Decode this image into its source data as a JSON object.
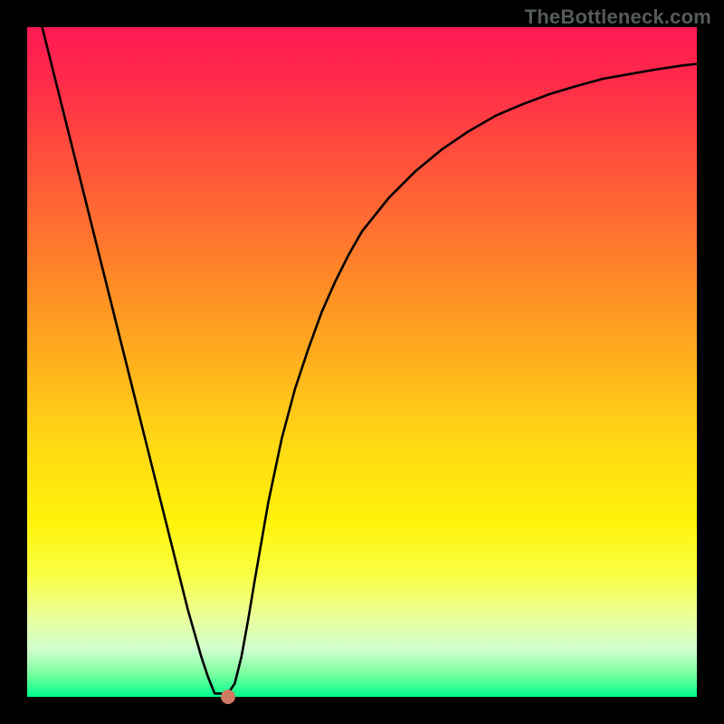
{
  "attribution": "TheBottleneck.com",
  "colors": {
    "background": "#000000",
    "marker": "#cf7a63",
    "curve": "#000000"
  },
  "chart_data": {
    "type": "line",
    "title": "",
    "xlabel": "",
    "ylabel": "",
    "xlim": [
      0,
      1
    ],
    "ylim": [
      0,
      1
    ],
    "x": [
      0.0,
      0.02,
      0.04,
      0.06,
      0.08,
      0.1,
      0.12,
      0.14,
      0.16,
      0.18,
      0.2,
      0.22,
      0.24,
      0.26,
      0.27,
      0.28,
      0.29,
      0.3,
      0.31,
      0.32,
      0.33,
      0.34,
      0.36,
      0.38,
      0.4,
      0.42,
      0.44,
      0.46,
      0.48,
      0.5,
      0.54,
      0.58,
      0.62,
      0.66,
      0.7,
      0.74,
      0.78,
      0.82,
      0.86,
      0.9,
      0.94,
      0.98,
      1.0
    ],
    "values": [
      1.09,
      1.01,
      0.93,
      0.85,
      0.77,
      0.69,
      0.61,
      0.53,
      0.45,
      0.37,
      0.29,
      0.21,
      0.13,
      0.06,
      0.03,
      0.005,
      0.005,
      0.005,
      0.02,
      0.06,
      0.115,
      0.175,
      0.29,
      0.385,
      0.46,
      0.52,
      0.575,
      0.62,
      0.66,
      0.695,
      0.745,
      0.785,
      0.818,
      0.845,
      0.868,
      0.885,
      0.9,
      0.912,
      0.923,
      0.93,
      0.937,
      0.943,
      0.945
    ],
    "marker": {
      "x": 0.3,
      "y": 0.0
    },
    "gradient_stops": [
      {
        "pct": 0,
        "color": "#ff1a53"
      },
      {
        "pct": 50,
        "color": "#ffb01d"
      },
      {
        "pct": 82,
        "color": "#f9ff45"
      },
      {
        "pct": 100,
        "color": "#00ff8d"
      }
    ]
  }
}
